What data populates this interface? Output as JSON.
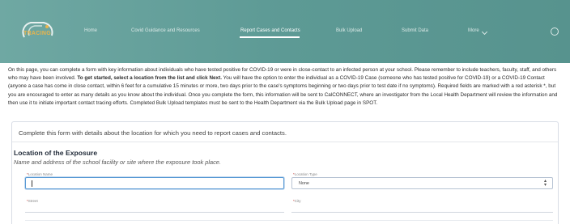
{
  "nav": {
    "logo_text": "TRACING",
    "items": [
      {
        "label": "Home"
      },
      {
        "label": "Covid Guidance and Resources"
      },
      {
        "label": "Report Cases and Contacts"
      },
      {
        "label": "Bulk Upload"
      },
      {
        "label": "Submit Data"
      },
      {
        "label": "More"
      }
    ]
  },
  "intro": {
    "p1": "On this page, you can complete a form with key information about individuals who have tested positive for COVID-19 or were in close-contact to an infected person at your school. Please remember to include teachers, faculty, staff, and others who may have been involved. ",
    "bold": "To get started, select a location from the list and click Next.",
    "p2": " You will have the option to enter the individual as a COVID-19 Case (someone who has tested positive for COVID-19) or a COVID-19 Contact (anyone a case has come in close contact, within 6 feet for a cumulative 15 minutes or more, two days prior to the case's symptoms beginning or two days prior to test date if no symptoms). Required fields are marked with a red asterisk *, but you are encouraged to enter as many details as you know about the individual. Once you complete the form, this information will be sent to CalCONNECT, where an investigator from the Local Health Department will review the information and then use it to initiate important contact tracing efforts. Completed Bulk Upload templates must be sent to the Health Department via the Bulk Upload page in SPOT."
  },
  "form": {
    "header": "Complete this form with details about the location for which you need to report cases and contacts.",
    "section_title": "Location of the Exposure",
    "section_subtitle": "Name and address of the school facility or site where the exposure took place.",
    "location_name_label": "Location Name",
    "location_type_label": "Location Type",
    "location_type_value": "None",
    "street_label": "Street",
    "city_label": "City"
  }
}
